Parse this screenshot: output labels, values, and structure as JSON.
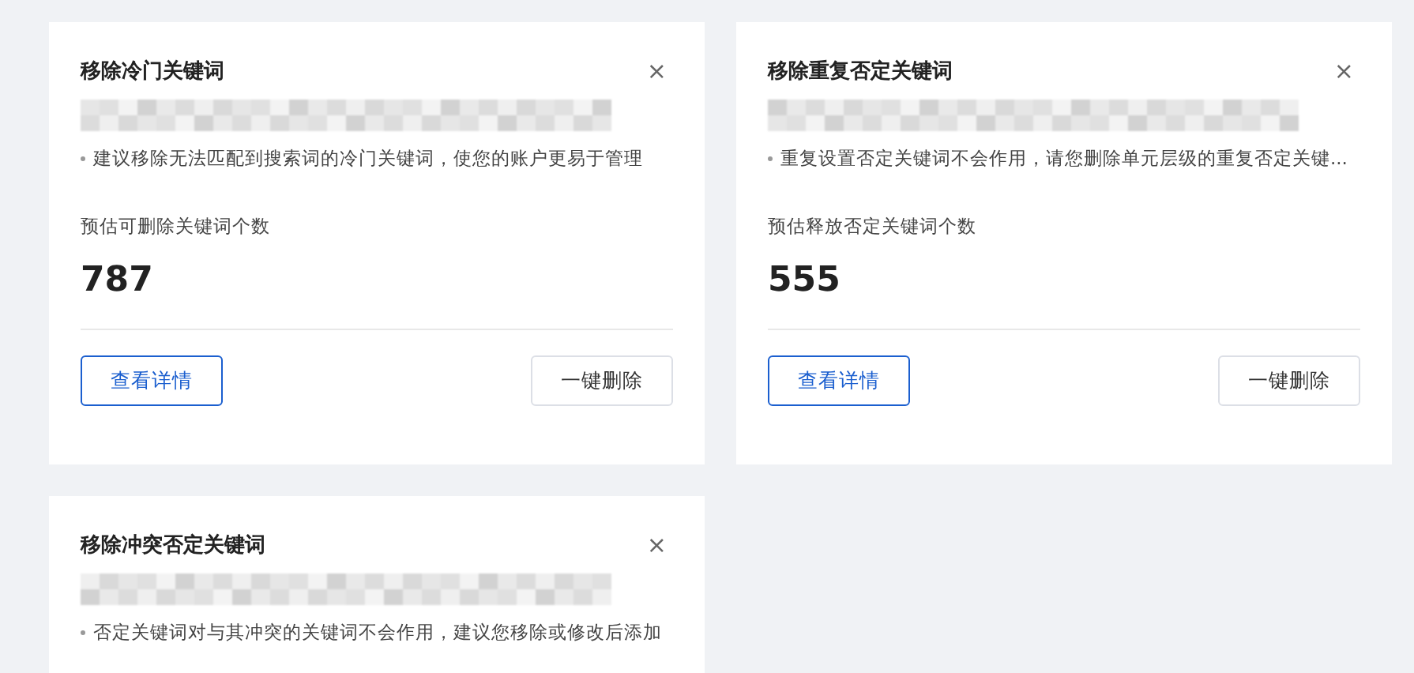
{
  "cards": [
    {
      "title": "移除冷门关键词",
      "close": "×",
      "description": "建议移除无法匹配到搜索词的冷门关键词，使您的账户更易于管理",
      "metric_label": "预估可删除关键词个数",
      "metric_value": "787",
      "buttons": [
        {
          "label": "查看详情",
          "kind": "primary"
        },
        {
          "label": "一键删除",
          "kind": "default"
        }
      ]
    },
    {
      "title": "移除重复否定关键词",
      "close": "×",
      "description": "重复设置否定关键词不会作用，请您删除单元层级的重复否定关键...",
      "metric_label": "预估释放否定关键词个数",
      "metric_value": "555",
      "buttons": [
        {
          "label": "查看详情",
          "kind": "primary"
        },
        {
          "label": "一键删除",
          "kind": "default"
        }
      ]
    },
    {
      "title": "移除冲突否定关键词",
      "close": "×",
      "description": "否定关键词对与其冲突的关键词不会作用，建议您移除或修改后添加"
    }
  ]
}
